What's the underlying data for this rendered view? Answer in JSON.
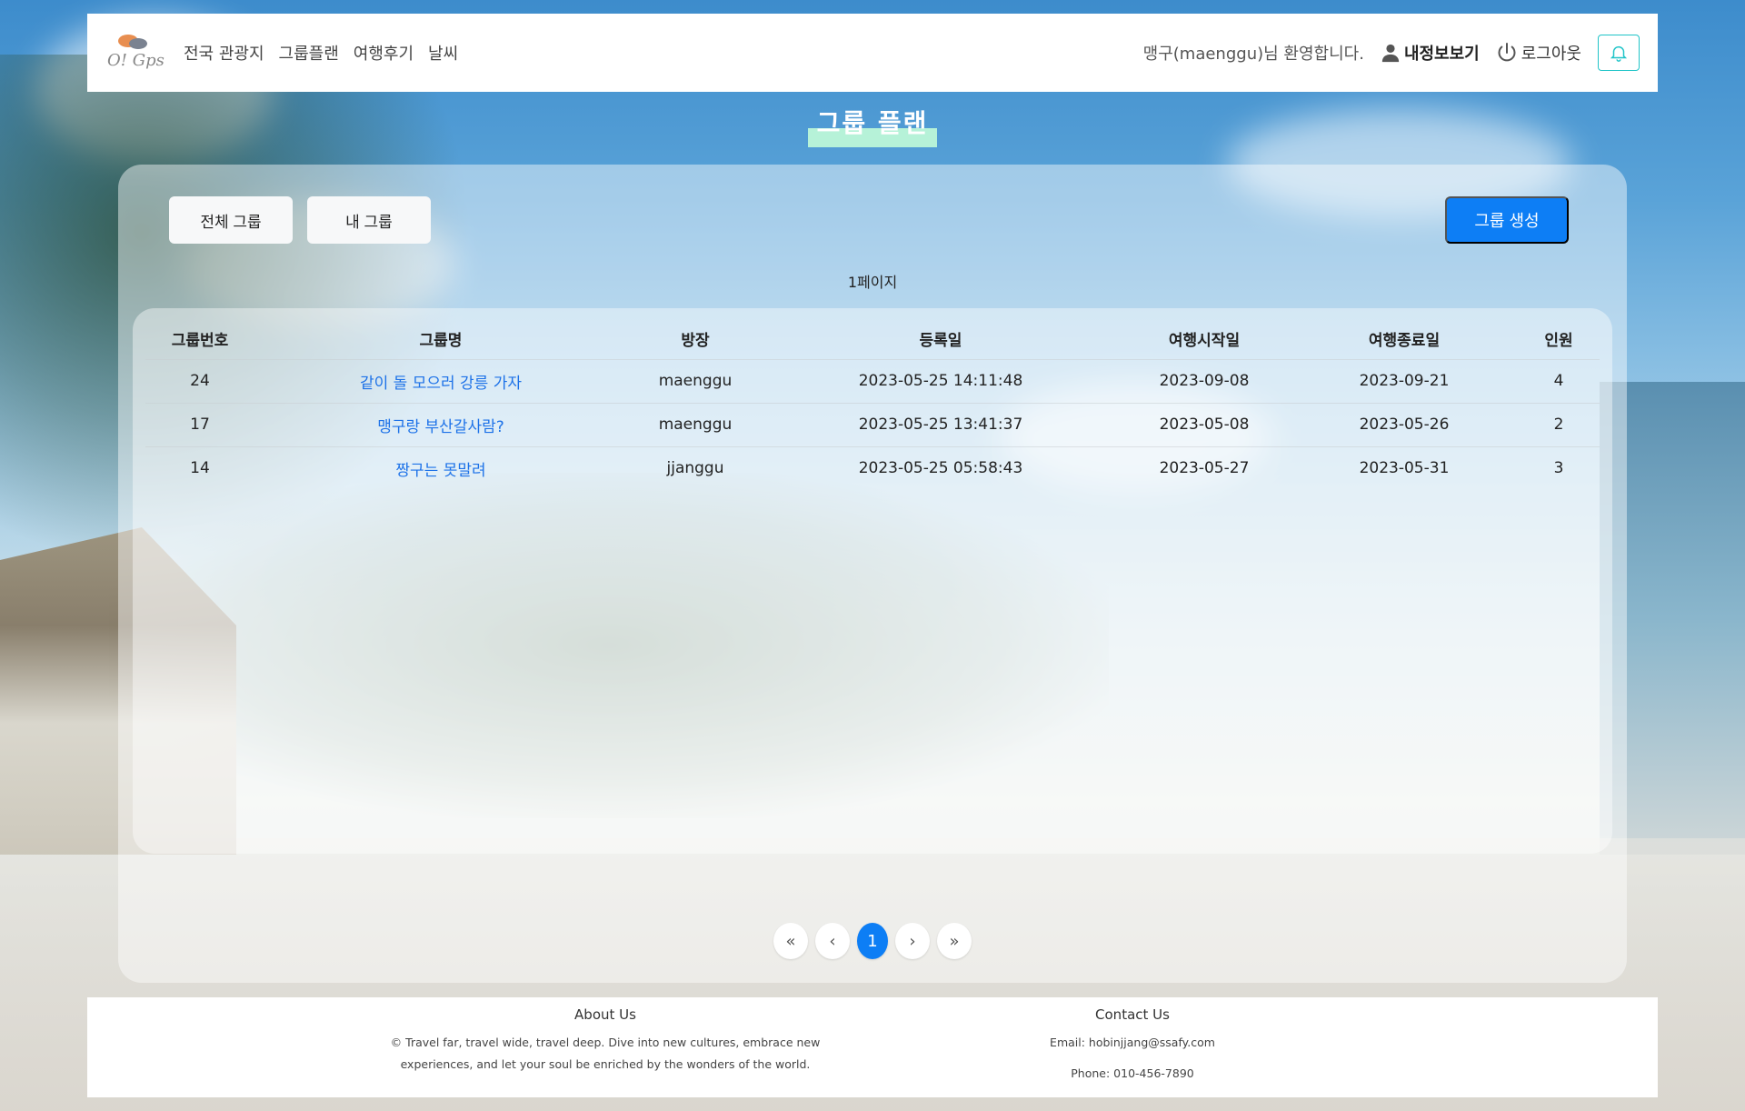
{
  "nav": {
    "logo_text": "O! Gps",
    "links": [
      "전국 관광지",
      "그룹플랜",
      "여행후기",
      "날씨"
    ],
    "welcome": "맹구(maenggu)님 환영합니다.",
    "profile_label": "내정보보기",
    "logout_label": "로그아웃"
  },
  "page": {
    "title": "그룹 플랜",
    "tab_all": "전체 그룹",
    "tab_mine": "내 그룹",
    "create_label": "그룹 생성",
    "page_count": "1페이지"
  },
  "table": {
    "headers": [
      "그룹번호",
      "그룹명",
      "방장",
      "등록일",
      "여행시작일",
      "여행종료일",
      "인원"
    ],
    "rows": [
      [
        "24",
        "같이 돌 모으러 강릉 가자",
        "maenggu",
        "2023-05-25 14:11:48",
        "2023-09-08",
        "2023-09-21",
        "4"
      ],
      [
        "17",
        "맹구랑 부산갈사람?",
        "maenggu",
        "2023-05-25 13:41:37",
        "2023-05-08",
        "2023-05-26",
        "2"
      ],
      [
        "14",
        "짱구는 못말려",
        "jjanggu",
        "2023-05-25 05:58:43",
        "2023-05-27",
        "2023-05-31",
        "3"
      ]
    ]
  },
  "pagination": {
    "first": "«",
    "prev": "‹",
    "current": "1",
    "next": "›",
    "last": "»"
  },
  "footer": {
    "about_title": "About Us",
    "about_line1": "Travel far, travel wide, travel deep. Dive into new cultures, embrace new",
    "about_line2": "experiences, and let your soul be enriched by the wonders of the world.",
    "copyright_symbol": "©",
    "contact_title": "Contact Us",
    "email": "Email: hobinjjang@ssafy.com",
    "phone": "Phone: 010-456-7890"
  },
  "colors": {
    "accent": "#0d7ef5",
    "link": "#1d72e8",
    "bell": "#20c4c8",
    "title_highlight": "#b6f2d8"
  },
  "icons": [
    "user-icon",
    "power-icon",
    "bell-icon"
  ]
}
